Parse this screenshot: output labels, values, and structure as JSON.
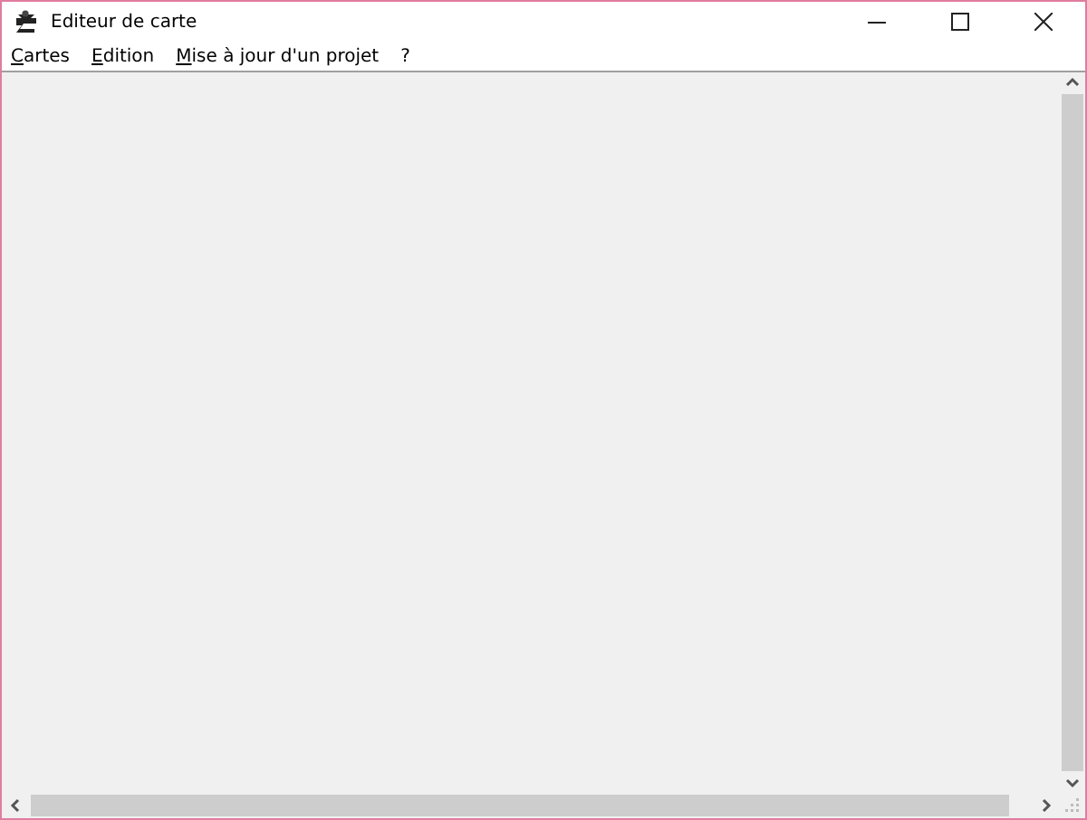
{
  "window": {
    "title": "Editeur de carte"
  },
  "menu": [
    {
      "label": "Cartes"
    },
    {
      "label": "Edition"
    },
    {
      "label": "Mise à jour d'un projet"
    },
    {
      "label": "?"
    }
  ]
}
